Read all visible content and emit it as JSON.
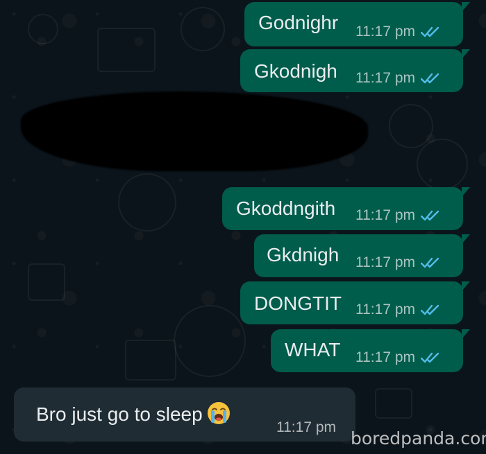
{
  "messages": [
    {
      "text": "Godnighr",
      "time": "11:17 pm",
      "status": "read-double-check-icon"
    },
    {
      "text": "Gkodnigh",
      "time": "11:17 pm",
      "status": "read-double-check-icon"
    },
    {
      "text": "Gkoddngith",
      "time": "11:17 pm",
      "status": "read-double-check-icon"
    },
    {
      "text": "Gkdnigh",
      "time": "11:17 pm",
      "status": "read-double-check-icon"
    },
    {
      "text": "DONGTIT",
      "time": "11:17 pm",
      "status": "read-double-check-icon"
    },
    {
      "text": "WHAT",
      "time": "11:17 pm",
      "status": "read-double-check-icon"
    },
    {
      "text": "Bro just go to sleep",
      "time": "11:17 pm",
      "emoji": "loudly-crying-face-icon"
    }
  ],
  "watermark": "boredpanda.com",
  "colors": {
    "background": "#0b141a",
    "outgoing_bubble": "#005c4b",
    "incoming_bubble": "#202c33",
    "tick_blue": "#53bdeb",
    "text": "#e9edef"
  }
}
